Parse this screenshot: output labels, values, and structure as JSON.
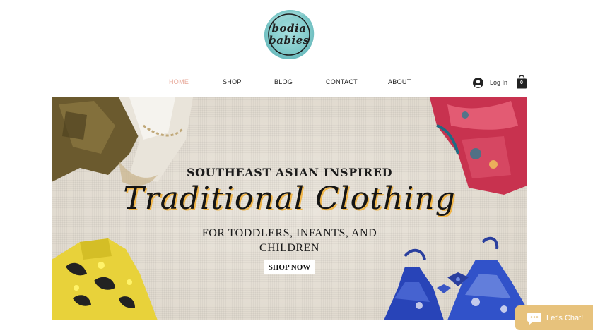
{
  "logo": {
    "line1": "bodia",
    "line2": "babies",
    "accent": "#7fc9c9"
  },
  "nav": {
    "items": [
      {
        "label": "HOME",
        "active": true
      },
      {
        "label": "SHOP"
      },
      {
        "label": "BLOG"
      },
      {
        "label": "CONTACT"
      },
      {
        "label": "ABOUT"
      }
    ],
    "active_color": "#e8a99a"
  },
  "account": {
    "login_label": "Log In",
    "avatar_icon": "user-avatar-icon"
  },
  "cart": {
    "count": "0",
    "icon": "shopping-bag-icon"
  },
  "hero": {
    "kicker": "SOUTHEAST ASIAN INSPIRED",
    "headline": "Traditional Clothing",
    "sub_line1": "FOR TODDLERS, INFANTS, AND",
    "sub_line2": "CHILDREN",
    "cta": "SHOP NOW",
    "headline_accent": "#f1b64a"
  },
  "chat": {
    "label": "Let's Chat!",
    "icon": "chat-bubble-icon",
    "color": "#e7c27c"
  }
}
